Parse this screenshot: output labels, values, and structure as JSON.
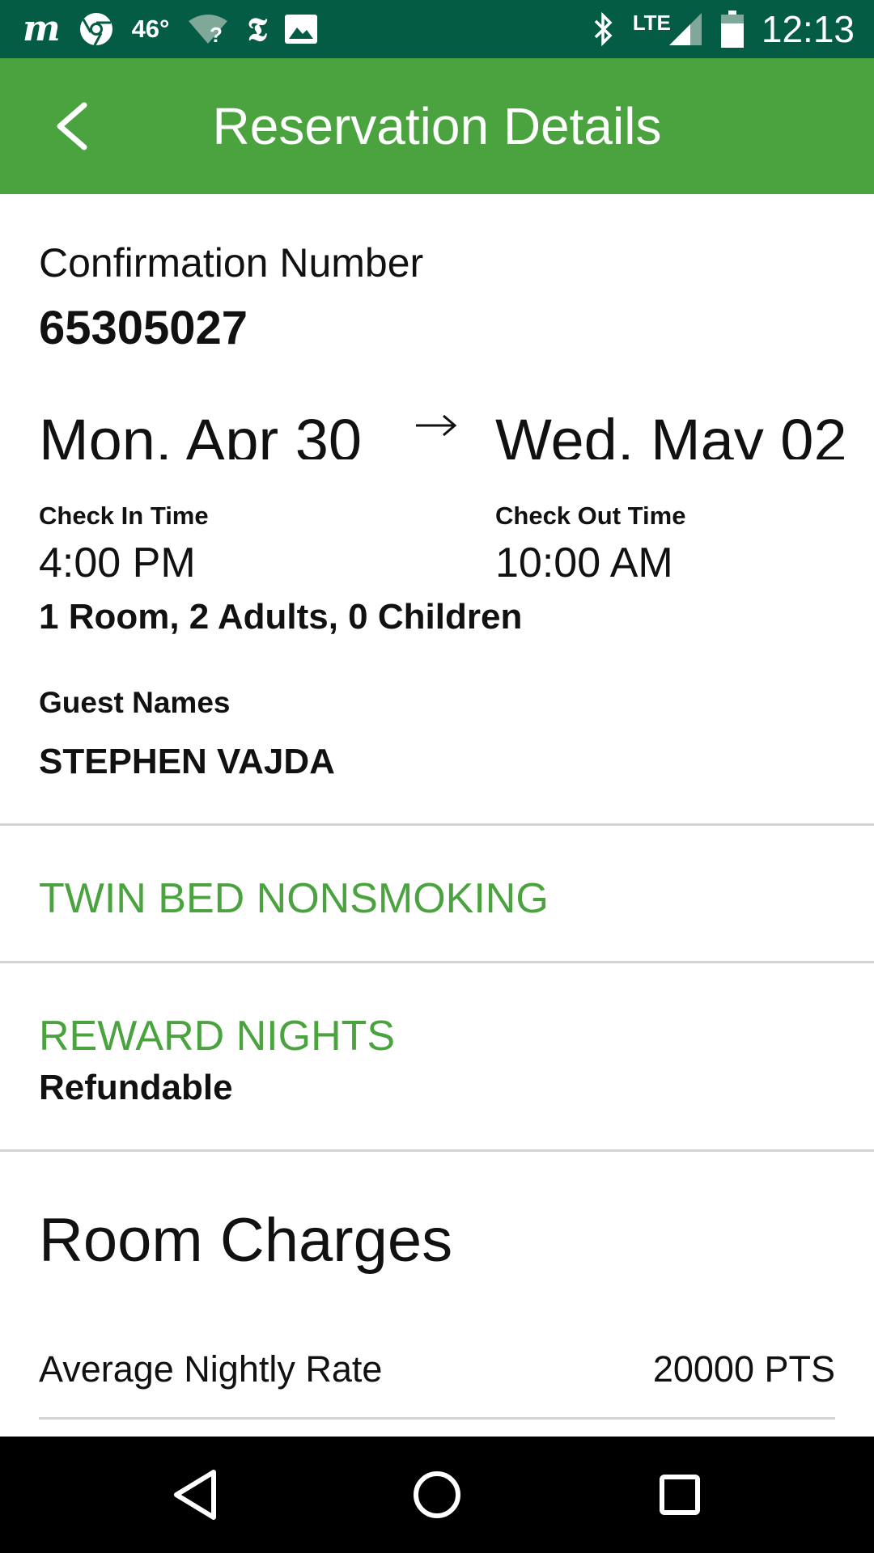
{
  "status_bar": {
    "icons_left": [
      "motorola-m-icon",
      "chrome-icon",
      "wifi-question-icon",
      "nyt-icon",
      "image-icon"
    ],
    "temperature": "46°",
    "icons_right": [
      "bluetooth-icon",
      "signal-icon",
      "battery-icon"
    ],
    "network": "LTE",
    "time": "12:13",
    "background_color": "#055c45"
  },
  "app_bar": {
    "title": "Reservation Details",
    "back_icon": "chevron-left-icon",
    "background_color": "#4aa33e"
  },
  "confirmation": {
    "label": "Confirmation Number",
    "number": "65305027"
  },
  "stay": {
    "check_in_date": "Mon. Apr 30",
    "check_out_date": "Wed. May 02",
    "arrow_icon": "arrow-right-icon",
    "check_in_label": "Check In Time",
    "check_in_time": "4:00 PM",
    "check_out_label": "Check Out Time",
    "check_out_time": "10:00 AM",
    "occupancy": "1 Room, 2 Adults, 0 Children"
  },
  "guests": {
    "label": "Guest Names",
    "names": [
      "STEPHEN VAJDA"
    ]
  },
  "room": {
    "type": "TWIN BED NONSMOKING"
  },
  "rate": {
    "name": "REWARD NIGHTS",
    "policy": "Refundable"
  },
  "charges": {
    "heading": "Room Charges",
    "rows": [
      {
        "label": "Average Nightly Rate",
        "value": "20000 PTS"
      }
    ]
  },
  "nav_bar": {
    "buttons": [
      "back-triangle-icon",
      "home-circle-icon",
      "recents-square-icon"
    ]
  },
  "colors": {
    "accent_green": "#4aa33e",
    "divider": "#d3d3d3"
  }
}
